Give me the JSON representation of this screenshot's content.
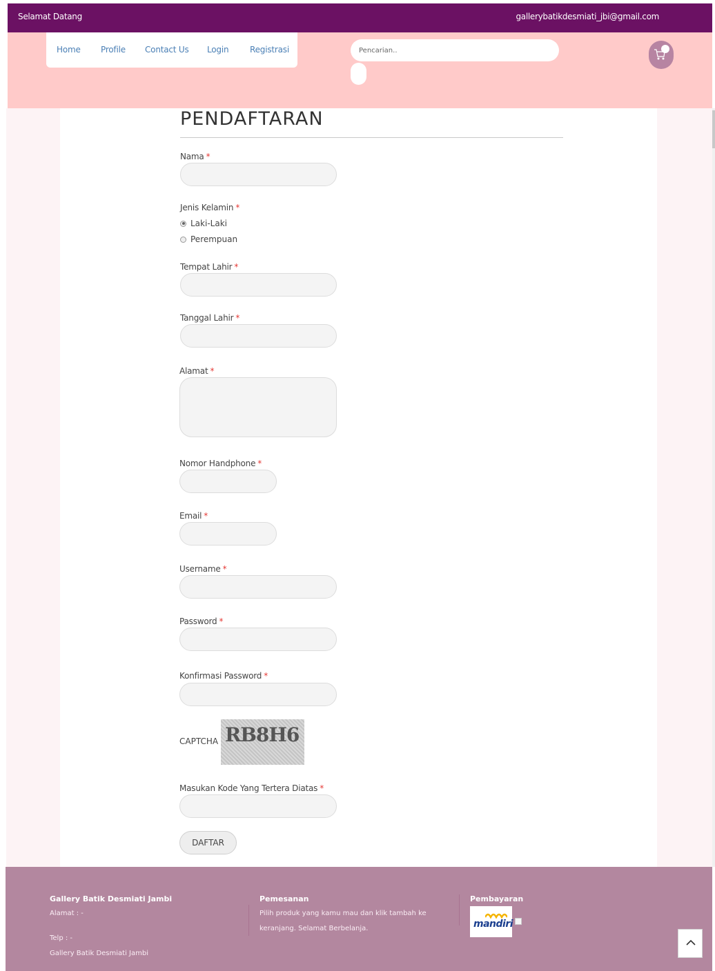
{
  "topbar": {
    "welcome": "Selamat Datang",
    "email": "gallerybatikdesmiati_jbi@gmail.com"
  },
  "nav": {
    "items": [
      {
        "label": "Home"
      },
      {
        "label": "Profile"
      },
      {
        "label": "Contact Us"
      },
      {
        "label": "Login"
      },
      {
        "label": "Registrasi"
      }
    ]
  },
  "search": {
    "placeholder": "Pencarian.."
  },
  "cart": {
    "icon": "cart-icon"
  },
  "form": {
    "title": "PENDAFTARAN",
    "required_mark": "*",
    "nama_label": "Nama",
    "gender_label": "Jenis Kelamin",
    "gender_options": [
      {
        "label": "Laki-Laki",
        "selected": true
      },
      {
        "label": "Perempuan",
        "selected": false
      }
    ],
    "tempat_lahir_label": "Tempat Lahir",
    "tanggal_lahir_label": "Tanggal Lahir",
    "alamat_label": "Alamat",
    "handphone_label": "Nomor Handphone",
    "email_label": "Email",
    "username_label": "Username",
    "password_label": "Password",
    "konfirmasi_label": "Konfirmasi Password",
    "captcha_label": "CAPTCHA :",
    "captcha_text": "RB8H6",
    "kode_label": "Masukan Kode Yang Tertera Diatas",
    "submit_label": "DAFTAR"
  },
  "footer": {
    "col1": {
      "title": "Gallery Batik Desmiati Jambi",
      "alamat": "Alamat : -",
      "telp": "Telp : -",
      "name": "Gallery Batik Desmiati Jambi"
    },
    "col2": {
      "title": "Pemesanan",
      "line1": "Pilih produk yang kamu mau dan klik tambah ke",
      "line2": "keranjang. Selamat Berbelanja."
    },
    "col3": {
      "title": "Pembayaran",
      "bank_logo": "mandiri"
    }
  },
  "colors": {
    "topbar": "#6b1163",
    "header": "#ffcac9",
    "footer": "#b3879f",
    "cart": "#b784a2",
    "link": "#4a7fb5",
    "required": "#e53935"
  }
}
